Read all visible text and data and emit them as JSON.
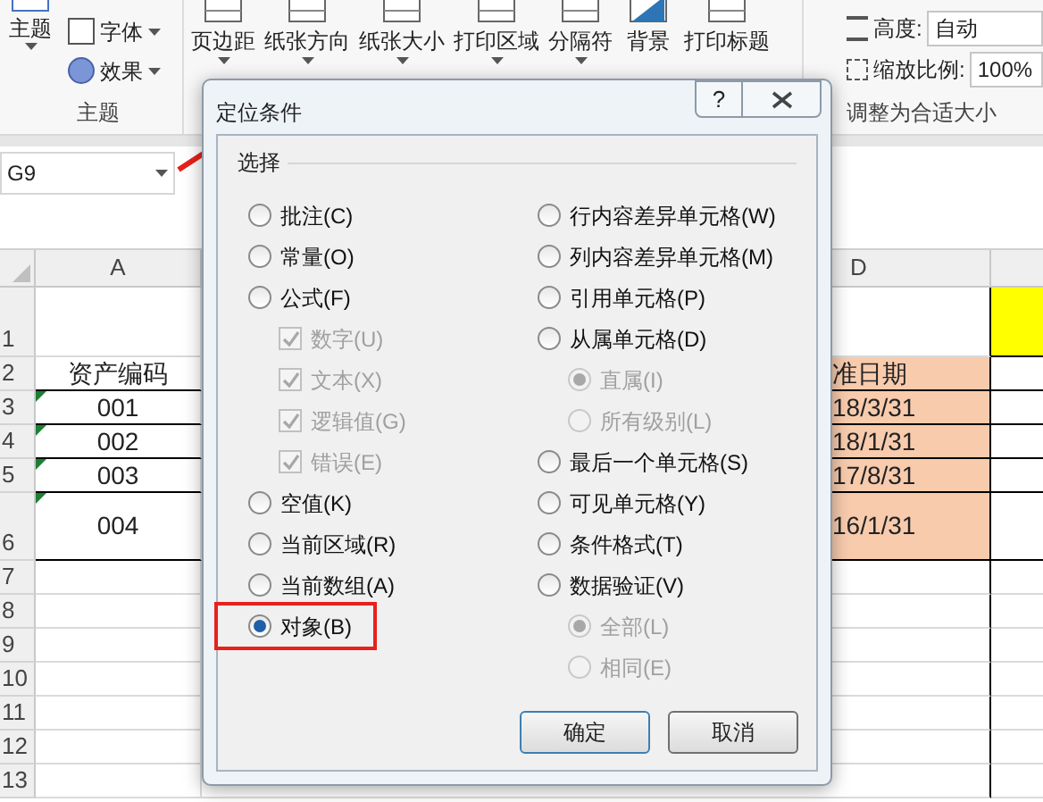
{
  "ribbon": {
    "theme_group": {
      "button": "主题",
      "items": [
        "字体",
        "效果"
      ],
      "label": "主题"
    },
    "page_setup_buttons": [
      "页边距",
      "纸张方向",
      "纸张大小",
      "打印区域",
      "分隔符",
      "背景",
      "打印标题"
    ],
    "scale_group": {
      "height_label": "高度:",
      "height_value": "自动",
      "scale_label": "缩放比例:",
      "scale_value": "100%",
      "label": "调整为合适大小"
    }
  },
  "name_box": "G9",
  "sheet": {
    "columns": [
      "A",
      "D"
    ],
    "rows": [
      {
        "number": "1",
        "e": {
          "color": "#ffff00"
        }
      },
      {
        "number": "2",
        "a": "资产编码",
        "d": {
          "text": "准日期",
          "color": "#f8cbad"
        }
      },
      {
        "number": "3",
        "a": "001",
        "d": {
          "text": "18/3/31",
          "color": "#f8cbad"
        },
        "error_flag": true
      },
      {
        "number": "4",
        "a": "002",
        "d": {
          "text": "18/1/31",
          "color": "#f8cbad"
        },
        "error_flag": true
      },
      {
        "number": "5",
        "a": "003",
        "d": {
          "text": "17/8/31",
          "color": "#f8cbad"
        },
        "error_flag": true
      },
      {
        "number": "6",
        "a": "004",
        "d": {
          "text": "16/1/31",
          "color": "#f8cbad"
        },
        "error_flag": true
      },
      {
        "number": "7"
      },
      {
        "number": "8"
      },
      {
        "number": "9"
      },
      {
        "number": "10"
      },
      {
        "number": "11"
      },
      {
        "number": "12"
      },
      {
        "number": "13"
      }
    ]
  },
  "dialog": {
    "title": "定位条件",
    "help": "?",
    "group_label": "选择",
    "left": [
      {
        "kind": "radio",
        "label": "批注(C)",
        "selected": false,
        "highlighted": false
      },
      {
        "kind": "radio",
        "label": "常量(O)",
        "selected": false,
        "highlighted": false
      },
      {
        "kind": "radio",
        "label": "公式(F)",
        "selected": false,
        "highlighted": false,
        "children": [
          {
            "kind": "checkbox",
            "label": "数字(U)",
            "checked": true,
            "disabled": true
          },
          {
            "kind": "checkbox",
            "label": "文本(X)",
            "checked": true,
            "disabled": true
          },
          {
            "kind": "checkbox",
            "label": "逻辑值(G)",
            "checked": true,
            "disabled": true
          },
          {
            "kind": "checkbox",
            "label": "错误(E)",
            "checked": true,
            "disabled": true
          }
        ]
      },
      {
        "kind": "radio",
        "label": "空值(K)",
        "selected": false,
        "highlighted": false
      },
      {
        "kind": "radio",
        "label": "当前区域(R)",
        "selected": false,
        "highlighted": false
      },
      {
        "kind": "radio",
        "label": "当前数组(A)",
        "selected": false,
        "highlighted": false
      },
      {
        "kind": "radio",
        "label": "对象(B)",
        "selected": true,
        "highlighted": true
      }
    ],
    "right": [
      {
        "kind": "radio",
        "label": "行内容差异单元格(W)",
        "selected": false,
        "highlighted": false
      },
      {
        "kind": "radio",
        "label": "列内容差异单元格(M)",
        "selected": false,
        "highlighted": false
      },
      {
        "kind": "radio",
        "label": "引用单元格(P)",
        "selected": false,
        "highlighted": false
      },
      {
        "kind": "radio",
        "label": "从属单元格(D)",
        "selected": false,
        "highlighted": false,
        "children": [
          {
            "kind": "radio",
            "label": "直属(I)",
            "selected": true,
            "disabled": true
          },
          {
            "kind": "radio",
            "label": "所有级别(L)",
            "selected": false,
            "disabled": true
          }
        ]
      },
      {
        "kind": "radio",
        "label": "最后一个单元格(S)",
        "selected": false,
        "highlighted": false
      },
      {
        "kind": "radio",
        "label": "可见单元格(Y)",
        "selected": false,
        "highlighted": false
      },
      {
        "kind": "radio",
        "label": "条件格式(T)",
        "selected": false,
        "highlighted": false
      },
      {
        "kind": "radio",
        "label": "数据验证(V)",
        "selected": false,
        "highlighted": false,
        "children": [
          {
            "kind": "radio",
            "label": "全部(L)",
            "selected": true,
            "disabled": true
          },
          {
            "kind": "radio",
            "label": "相同(E)",
            "selected": false,
            "disabled": true
          }
        ]
      }
    ],
    "buttons": [
      "确定",
      "取消"
    ]
  }
}
